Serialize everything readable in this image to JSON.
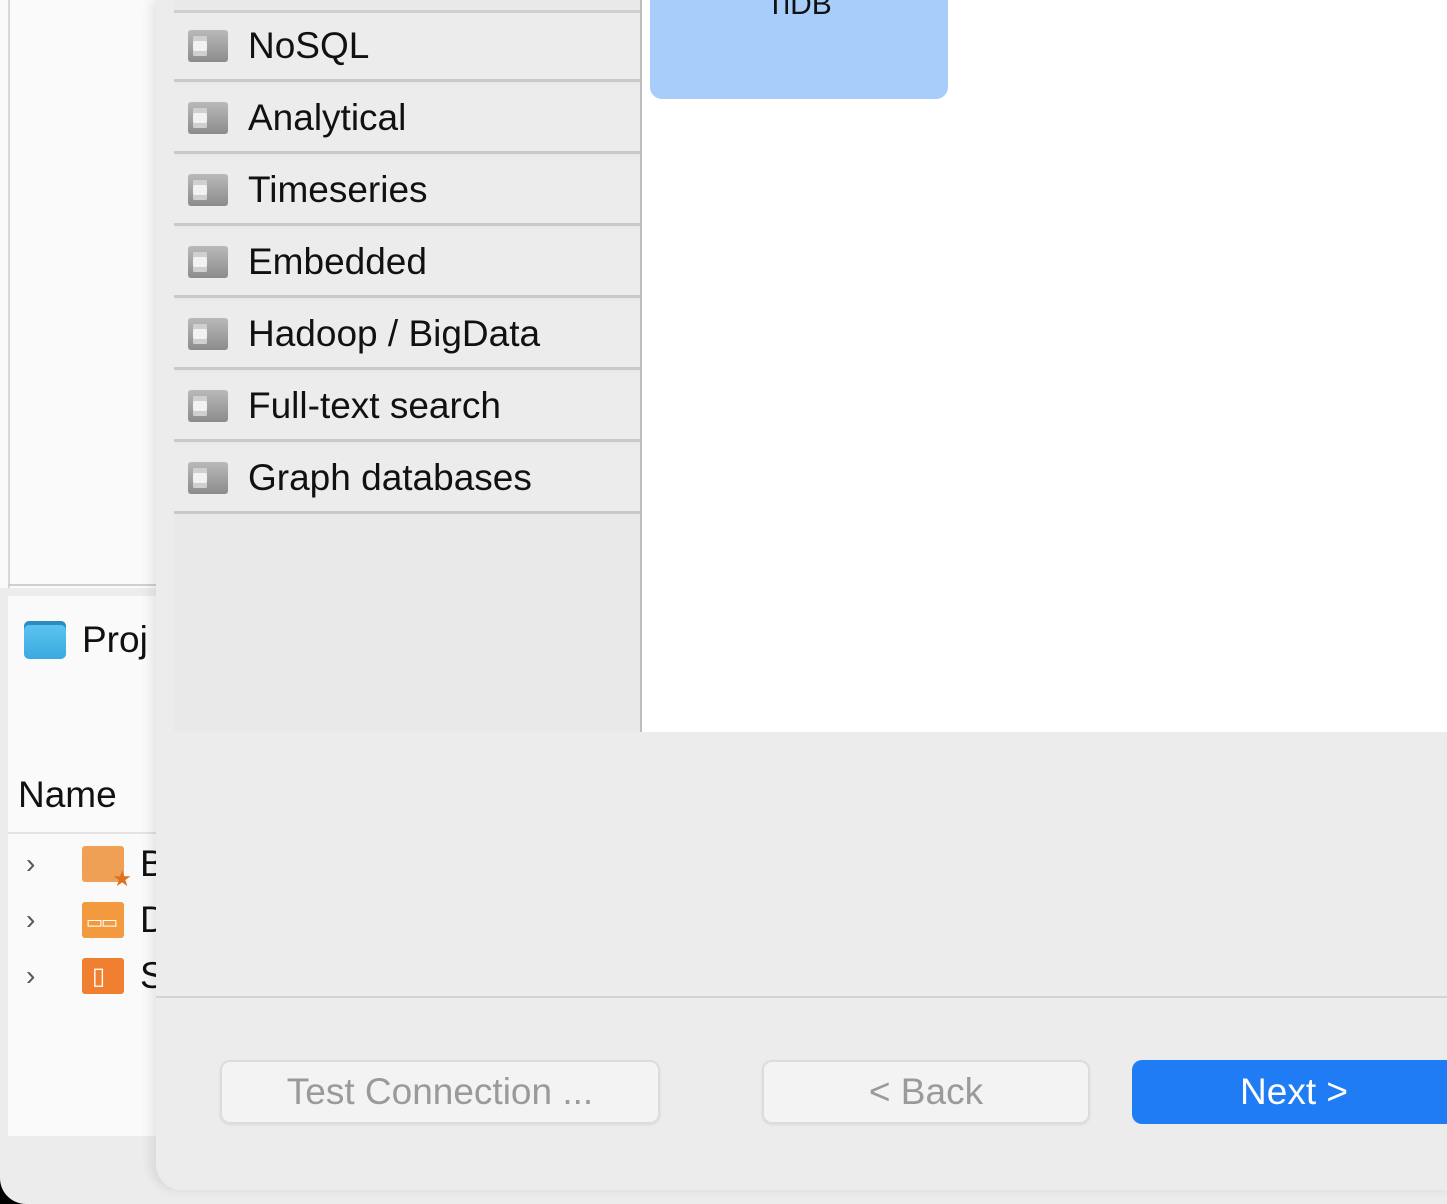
{
  "background_window": {
    "project_panel": {
      "title": "Proj",
      "column_header": "Name",
      "tree": [
        {
          "label": "B",
          "icon": "bookmarks-folder-icon"
        },
        {
          "label": "D",
          "icon": "diagrams-folder-icon"
        },
        {
          "label": "S",
          "icon": "scripts-folder-icon"
        }
      ]
    }
  },
  "dialog": {
    "categories": [
      {
        "label": "NoSQL",
        "icon": "database-folder-icon"
      },
      {
        "label": "Analytical",
        "icon": "database-folder-icon"
      },
      {
        "label": "Timeseries",
        "icon": "database-folder-icon"
      },
      {
        "label": "Embedded",
        "icon": "database-folder-icon"
      },
      {
        "label": "Hadoop / BigData",
        "icon": "database-folder-icon"
      },
      {
        "label": "Full-text search",
        "icon": "database-folder-icon"
      },
      {
        "label": "Graph databases",
        "icon": "database-folder-icon"
      }
    ],
    "selected_driver": {
      "label": "TiDB"
    },
    "buttons": {
      "test_connection": "Test Connection ...",
      "back": "< Back",
      "next": "Next >"
    }
  },
  "colors": {
    "selected_tile": "#a9cdfb",
    "primary_button": "#1f7cf5"
  }
}
